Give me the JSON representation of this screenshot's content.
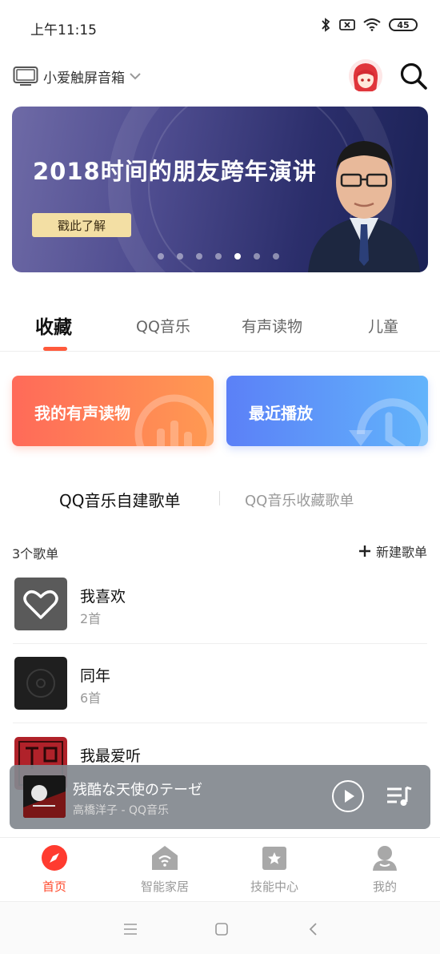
{
  "status_bar": {
    "time": "上午11:15",
    "battery": "45"
  },
  "header": {
    "device_name": "小爱触屏音箱"
  },
  "banner": {
    "title": "2018时间的朋友跨年演讲",
    "cta": "戳此了解",
    "dots": 7,
    "active_dot": 4
  },
  "tabs": [
    {
      "label": "收藏",
      "active": true
    },
    {
      "label": "QQ音乐",
      "active": false
    },
    {
      "label": "有声读物",
      "active": false
    },
    {
      "label": "儿童",
      "active": false
    }
  ],
  "cards": {
    "audiobooks": "我的有声读物",
    "recent": "最近播放"
  },
  "playlist_switch": {
    "self_created": "QQ音乐自建歌单",
    "favorited": "QQ音乐收藏歌单"
  },
  "list_head": {
    "count": "3个歌单",
    "new_playlist": "新建歌单"
  },
  "playlists": [
    {
      "name": "我喜欢",
      "count": "2首"
    },
    {
      "name": "同年",
      "count": "6首"
    },
    {
      "name": "我最爱听",
      "count": ""
    }
  ],
  "mini_player": {
    "title": "残酷な天使のテーゼ",
    "artist": "高橋洋子 - QQ音乐"
  },
  "bottom_nav": [
    {
      "label": "首页",
      "icon": "compass-icon",
      "active": true
    },
    {
      "label": "智能家居",
      "icon": "smart-home-icon",
      "active": false
    },
    {
      "label": "技能中心",
      "icon": "skill-star-icon",
      "active": false
    },
    {
      "label": "我的",
      "icon": "profile-icon",
      "active": false
    }
  ],
  "colors": {
    "accent": "#ff5a3c",
    "card_orange": "#ff7a55",
    "card_blue": "#5b8ef8"
  }
}
